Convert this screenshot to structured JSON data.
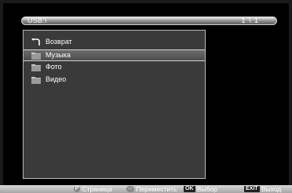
{
  "header": {
    "path": "USB:\\",
    "page_counter": "1 \\ 1"
  },
  "file_list": {
    "items": [
      {
        "label": "Возврат",
        "icon": "back-icon",
        "selected": false
      },
      {
        "label": "Музыка",
        "icon": "folder-icon",
        "selected": true
      },
      {
        "label": "Фото",
        "icon": "folder-icon",
        "selected": false
      },
      {
        "label": "Видео",
        "icon": "folder-icon",
        "selected": false
      }
    ]
  },
  "footer": {
    "page_key": "P",
    "page_label": "Страница",
    "move_label": "Переместить",
    "ok_key": "OK",
    "ok_label": "Выбор",
    "exit_key": "EXIT",
    "exit_label": "Выход"
  }
}
